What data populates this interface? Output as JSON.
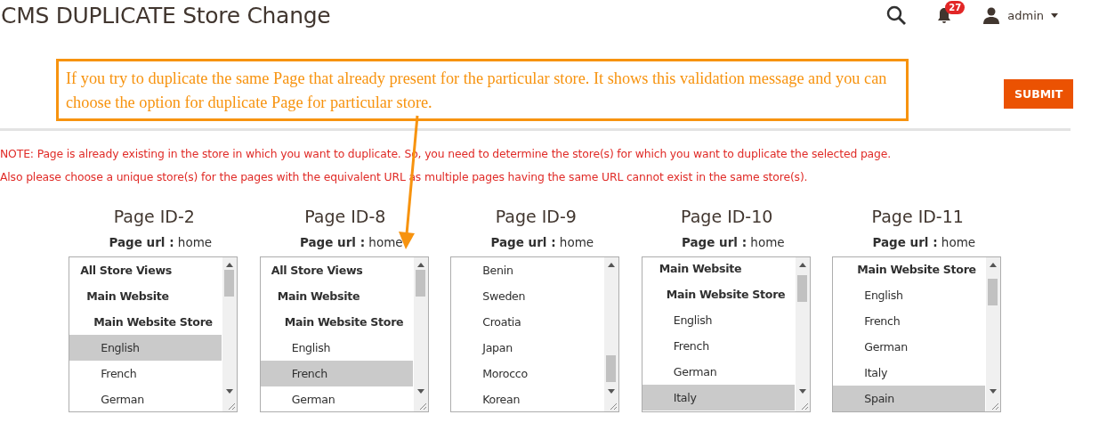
{
  "header": {
    "title": "CMS DUPLICATE Store Change",
    "notifications": {
      "count": "27"
    },
    "user": {
      "name": "admin"
    }
  },
  "callout": {
    "text": "If you try to duplicate the same Page that already present for the particular store. It shows this validation message and you can choose the option for duplicate Page for particular store."
  },
  "submit_button": "SUBMIT",
  "notes": [
    "NOTE: Page is already existing in the store in which you want to duplicate. So, you need to determine the store(s) for which you want to duplicate the selected page.",
    "Also please choose a unique store(s) for the pages with the equivalent URL as multiple pages having the same URL cannot exist in the same store(s)."
  ],
  "pages": [
    {
      "title": "Page ID-2",
      "url_label": "Page url :",
      "url": "home",
      "options": [
        {
          "kind": "all",
          "label": "All Store Views",
          "selected": false
        },
        {
          "kind": "website",
          "label": "Main Website",
          "selected": false
        },
        {
          "kind": "store",
          "label": "Main Website Store",
          "selected": false
        },
        {
          "kind": "view",
          "label": "English",
          "selected": true
        },
        {
          "kind": "view",
          "label": "French",
          "selected": false
        },
        {
          "kind": "view",
          "label": "German",
          "selected": false
        }
      ]
    },
    {
      "title": "Page ID-8",
      "url_label": "Page url :",
      "url": "home",
      "options": [
        {
          "kind": "all",
          "label": "All Store Views",
          "selected": false
        },
        {
          "kind": "website",
          "label": "Main Website",
          "selected": false
        },
        {
          "kind": "store",
          "label": "Main Website Store",
          "selected": false
        },
        {
          "kind": "view",
          "label": "English",
          "selected": false
        },
        {
          "kind": "view",
          "label": "French",
          "selected": true
        },
        {
          "kind": "view",
          "label": "German",
          "selected": false
        }
      ]
    },
    {
      "title": "Page ID-9",
      "url_label": "Page url :",
      "url": "home",
      "options": [
        {
          "kind": "view",
          "label": "Benin",
          "selected": false
        },
        {
          "kind": "view",
          "label": "Sweden",
          "selected": false
        },
        {
          "kind": "view",
          "label": "Croatia",
          "selected": false
        },
        {
          "kind": "view",
          "label": "Japan",
          "selected": false
        },
        {
          "kind": "view",
          "label": "Morocco",
          "selected": false
        },
        {
          "kind": "view",
          "label": "Korean",
          "selected": false
        }
      ]
    },
    {
      "title": "Page ID-10",
      "url_label": "Page url :",
      "url": "home",
      "options": [
        {
          "kind": "website",
          "label": "Main Website",
          "selected": false
        },
        {
          "kind": "store",
          "label": "Main Website Store",
          "selected": false
        },
        {
          "kind": "view",
          "label": "English",
          "selected": false
        },
        {
          "kind": "view",
          "label": "French",
          "selected": false
        },
        {
          "kind": "view",
          "label": "German",
          "selected": false
        },
        {
          "kind": "view",
          "label": "Italy",
          "selected": true
        }
      ]
    },
    {
      "title": "Page ID-11",
      "url_label": "Page url :",
      "url": "home",
      "options": [
        {
          "kind": "store",
          "label": "Main Website Store",
          "selected": false
        },
        {
          "kind": "view",
          "label": "English",
          "selected": false
        },
        {
          "kind": "view",
          "label": "French",
          "selected": false
        },
        {
          "kind": "view",
          "label": "German",
          "selected": false
        },
        {
          "kind": "view",
          "label": "Italy",
          "selected": false
        },
        {
          "kind": "view",
          "label": "Spain",
          "selected": true
        }
      ]
    }
  ]
}
